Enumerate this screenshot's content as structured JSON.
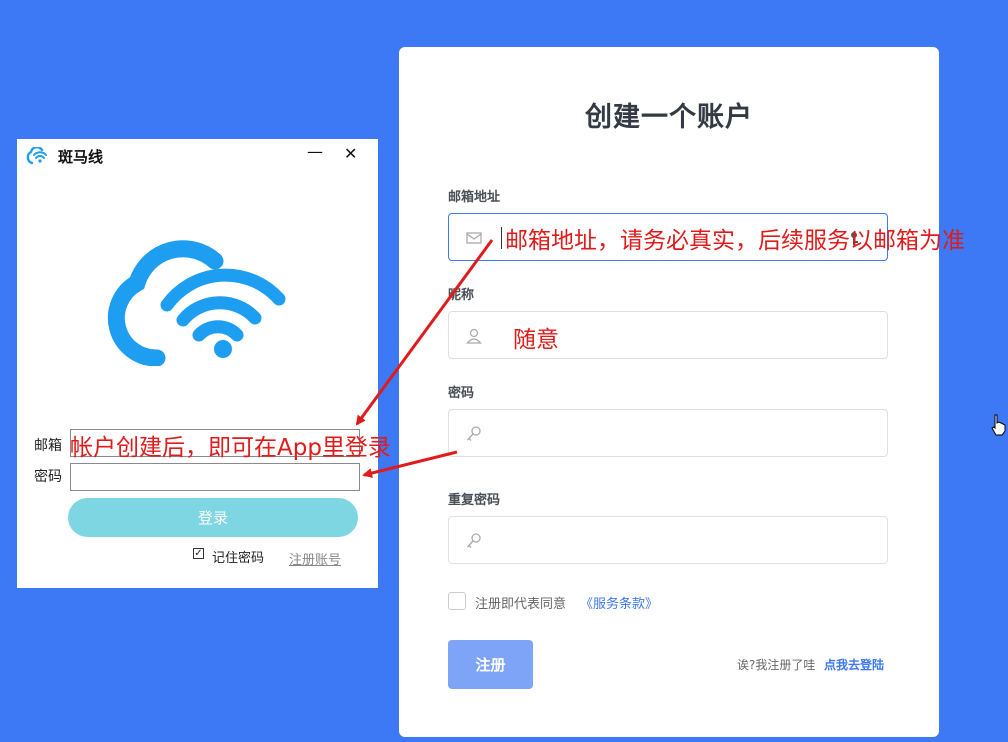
{
  "register": {
    "title": "创建一个账户",
    "email_label": "邮箱地址",
    "nickname_label": "昵称",
    "password_label": "密码",
    "confirm_password_label": "重复密码",
    "agree_text": "注册即代表同意",
    "terms_link": "《服务条款》",
    "submit_label": "注册",
    "login_hint": "诶?我注册了哇",
    "login_link": "点我去登陆"
  },
  "app_window": {
    "title": "斑马线",
    "minimize": "—",
    "close": "✕",
    "email_label": "邮箱",
    "password_label": "密码",
    "login_label": "登录",
    "remember_label": "记住密码",
    "remember_checked": true,
    "register_link": "注册账号"
  },
  "annotations": {
    "email_note": "邮箱地址，请务必真实，后续服务以邮箱为准",
    "nickname_note": "随意",
    "app_note": "帐户创建后，即可在App里登录"
  },
  "colors": {
    "background": "#3d78f5",
    "annotation": "#e01b1b",
    "app_accent": "#1e9ef0",
    "app_login_button": "#7fd6e3"
  }
}
